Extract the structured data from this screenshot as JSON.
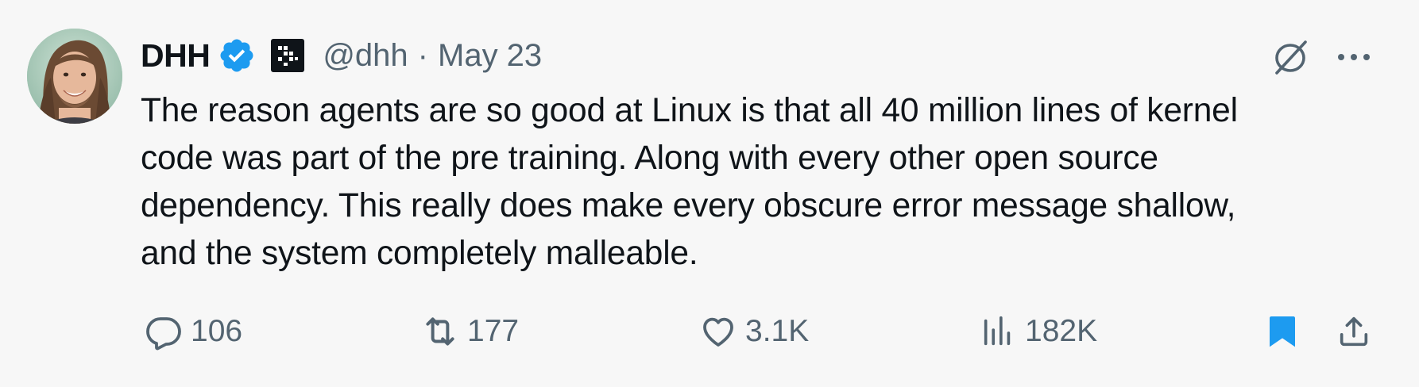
{
  "author": {
    "name": "DHH",
    "handle": "@dhh",
    "separator": "·",
    "date": "May 23"
  },
  "icons": {
    "verified": "verified-badge-icon",
    "affiliate": "affiliate-logo-icon",
    "grok": "grok-icon",
    "more": "more-icon"
  },
  "tweet": {
    "text": "The reason agents are so good at Linux is that all 40 million lines of kernel\ncode was part of the pre training. Along with every other open source\ndependency. This really does make every obscure error message shallow,\nand the system completely malleable."
  },
  "actions": {
    "replies": "106",
    "retweets": "177",
    "likes": "3.1K",
    "views": "182K"
  },
  "colors": {
    "verified_blue": "#1d9bf0",
    "secondary_text": "#536471",
    "background": "#f7f7f7"
  }
}
